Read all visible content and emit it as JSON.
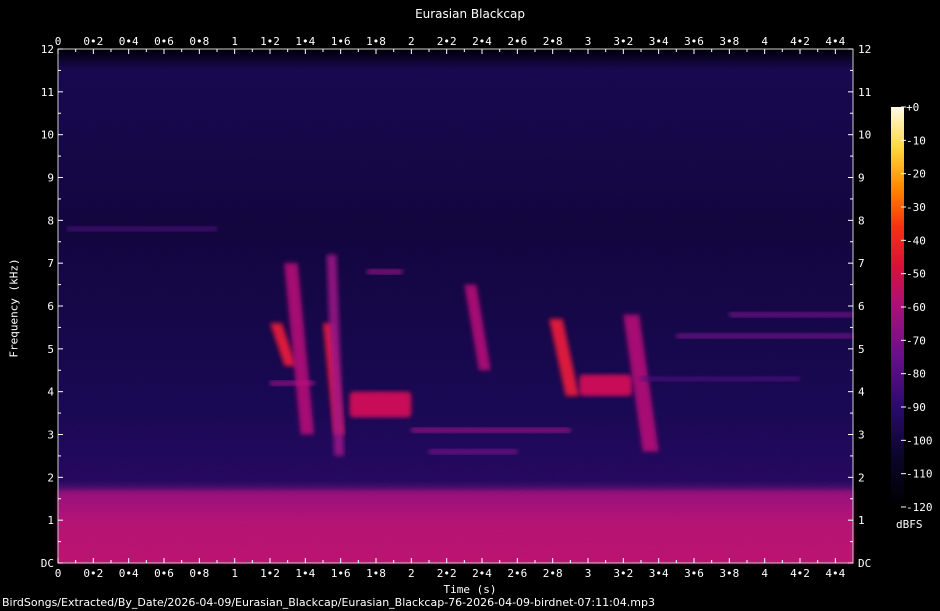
{
  "chart_data": {
    "type": "heatmap",
    "title": "Eurasian Blackcap",
    "xlabel": "Time (s)",
    "ylabel": "Frequency (kHz)",
    "xlim": [
      0,
      4.5
    ],
    "ylim": [
      0,
      12
    ],
    "x_ticks": [
      "0",
      "0•2",
      "0•4",
      "0•6",
      "0•8",
      "1",
      "1•2",
      "1•4",
      "1•6",
      "1•8",
      "2",
      "2•2",
      "2•4",
      "2•6",
      "2•8",
      "3",
      "3•2",
      "3•4",
      "3•6",
      "3•8",
      "4",
      "4•2",
      "4•4"
    ],
    "y_ticks": [
      "DC",
      "1",
      "2",
      "3",
      "4",
      "5",
      "6",
      "7",
      "8",
      "9",
      "10",
      "11",
      "12"
    ],
    "colorbar": {
      "label": "dBFS",
      "ticks": [
        "+0",
        "-10",
        "-20",
        "-30",
        "-40",
        "-50",
        "-60",
        "-70",
        "-80",
        "-90",
        "-100",
        "-110",
        "-120"
      ],
      "range": [
        -120,
        0
      ]
    },
    "features": [
      {
        "kind": "noise-band",
        "t0": 0.0,
        "t1": 4.5,
        "f0": 0.0,
        "f1": 1.7,
        "level": -70
      },
      {
        "kind": "tone",
        "t0": 0.05,
        "t1": 0.9,
        "f0": 7.8,
        "f1": 7.8,
        "level": -95
      },
      {
        "kind": "sweep",
        "t0": 1.2,
        "t1": 1.35,
        "f0": 5.6,
        "f1": 4.6,
        "level": -60
      },
      {
        "kind": "tone",
        "t0": 1.2,
        "t1": 1.45,
        "f0": 4.2,
        "f1": 4.2,
        "level": -80
      },
      {
        "kind": "sweep",
        "t0": 1.28,
        "t1": 1.45,
        "f0": 7.0,
        "f1": 3.0,
        "level": -75
      },
      {
        "kind": "sweep",
        "t0": 1.5,
        "t1": 1.62,
        "f0": 5.6,
        "f1": 3.0,
        "level": -62
      },
      {
        "kind": "sweep",
        "t0": 1.52,
        "t1": 1.62,
        "f0": 7.2,
        "f1": 2.5,
        "level": -80
      },
      {
        "kind": "blob",
        "t0": 1.65,
        "t1": 2.0,
        "f0": 3.4,
        "f1": 4.0,
        "level": -65
      },
      {
        "kind": "tone",
        "t0": 1.75,
        "t1": 1.95,
        "f0": 6.8,
        "f1": 6.8,
        "level": -82
      },
      {
        "kind": "sweep",
        "t0": 2.3,
        "t1": 2.45,
        "f0": 6.5,
        "f1": 4.5,
        "level": -70
      },
      {
        "kind": "tone",
        "t0": 2.0,
        "t1": 2.9,
        "f0": 3.1,
        "f1": 3.1,
        "level": -82
      },
      {
        "kind": "tone",
        "t0": 2.1,
        "t1": 2.6,
        "f0": 2.6,
        "f1": 2.6,
        "level": -85
      },
      {
        "kind": "sweep",
        "t0": 2.78,
        "t1": 2.95,
        "f0": 5.7,
        "f1": 3.9,
        "level": -62
      },
      {
        "kind": "blob",
        "t0": 2.95,
        "t1": 3.25,
        "f0": 3.9,
        "f1": 4.4,
        "level": -66
      },
      {
        "kind": "sweep",
        "t0": 3.2,
        "t1": 3.4,
        "f0": 5.8,
        "f1": 2.6,
        "level": -75
      },
      {
        "kind": "tone",
        "t0": 3.5,
        "t1": 4.5,
        "f0": 5.3,
        "f1": 5.3,
        "level": -85
      },
      {
        "kind": "tone",
        "t0": 3.8,
        "t1": 4.5,
        "f0": 5.8,
        "f1": 5.8,
        "level": -88
      },
      {
        "kind": "tone",
        "t0": 3.3,
        "t1": 4.2,
        "f0": 4.3,
        "f1": 4.3,
        "level": -90
      }
    ]
  },
  "footer": {
    "filename": "BirdSongs/Extracted/By_Date/2026-04-09/Eurasian_Blackcap/Eurasian_Blackcap-76-2026-04-09-birdnet-07:11:04.mp3"
  }
}
